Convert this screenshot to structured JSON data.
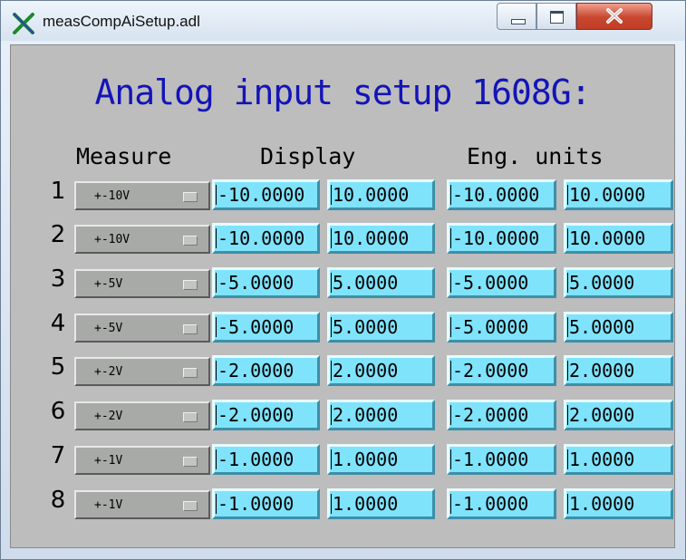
{
  "window": {
    "title": "measCompAiSetup.adl",
    "buttons": {
      "minimize": "minimize",
      "maximize": "maximize",
      "close": "close"
    }
  },
  "heading": "Analog input setup 1608G:",
  "columns": {
    "measure": "Measure",
    "display": "Display",
    "eng_units": "Eng. units"
  },
  "rows": [
    {
      "num": "1",
      "range": "+-10V",
      "disp_low": "-10.0000",
      "disp_high": "10.0000",
      "eng_low": "-10.0000",
      "eng_high": "10.0000"
    },
    {
      "num": "2",
      "range": "+-10V",
      "disp_low": "-10.0000",
      "disp_high": "10.0000",
      "eng_low": "-10.0000",
      "eng_high": "10.0000"
    },
    {
      "num": "3",
      "range": "+-5V",
      "disp_low": "-5.0000",
      "disp_high": "5.0000",
      "eng_low": "-5.0000",
      "eng_high": "5.0000"
    },
    {
      "num": "4",
      "range": "+-5V",
      "disp_low": "-5.0000",
      "disp_high": "5.0000",
      "eng_low": "-5.0000",
      "eng_high": "5.0000"
    },
    {
      "num": "5",
      "range": "+-2V",
      "disp_low": "-2.0000",
      "disp_high": "2.0000",
      "eng_low": "-2.0000",
      "eng_high": "2.0000"
    },
    {
      "num": "6",
      "range": "+-2V",
      "disp_low": "-2.0000",
      "disp_high": "2.0000",
      "eng_low": "-2.0000",
      "eng_high": "2.0000"
    },
    {
      "num": "7",
      "range": "+-1V",
      "disp_low": "-1.0000",
      "disp_high": "1.0000",
      "eng_low": "-1.0000",
      "eng_high": "1.0000"
    },
    {
      "num": "8",
      "range": "+-1V",
      "disp_low": "-1.0000",
      "disp_high": "1.0000",
      "eng_low": "-1.0000",
      "eng_high": "1.0000"
    }
  ],
  "colors": {
    "heading": "#1414b8",
    "panel": "#bdbdbd",
    "field": "#7fe3fb",
    "menu": "#a8aaa8"
  }
}
